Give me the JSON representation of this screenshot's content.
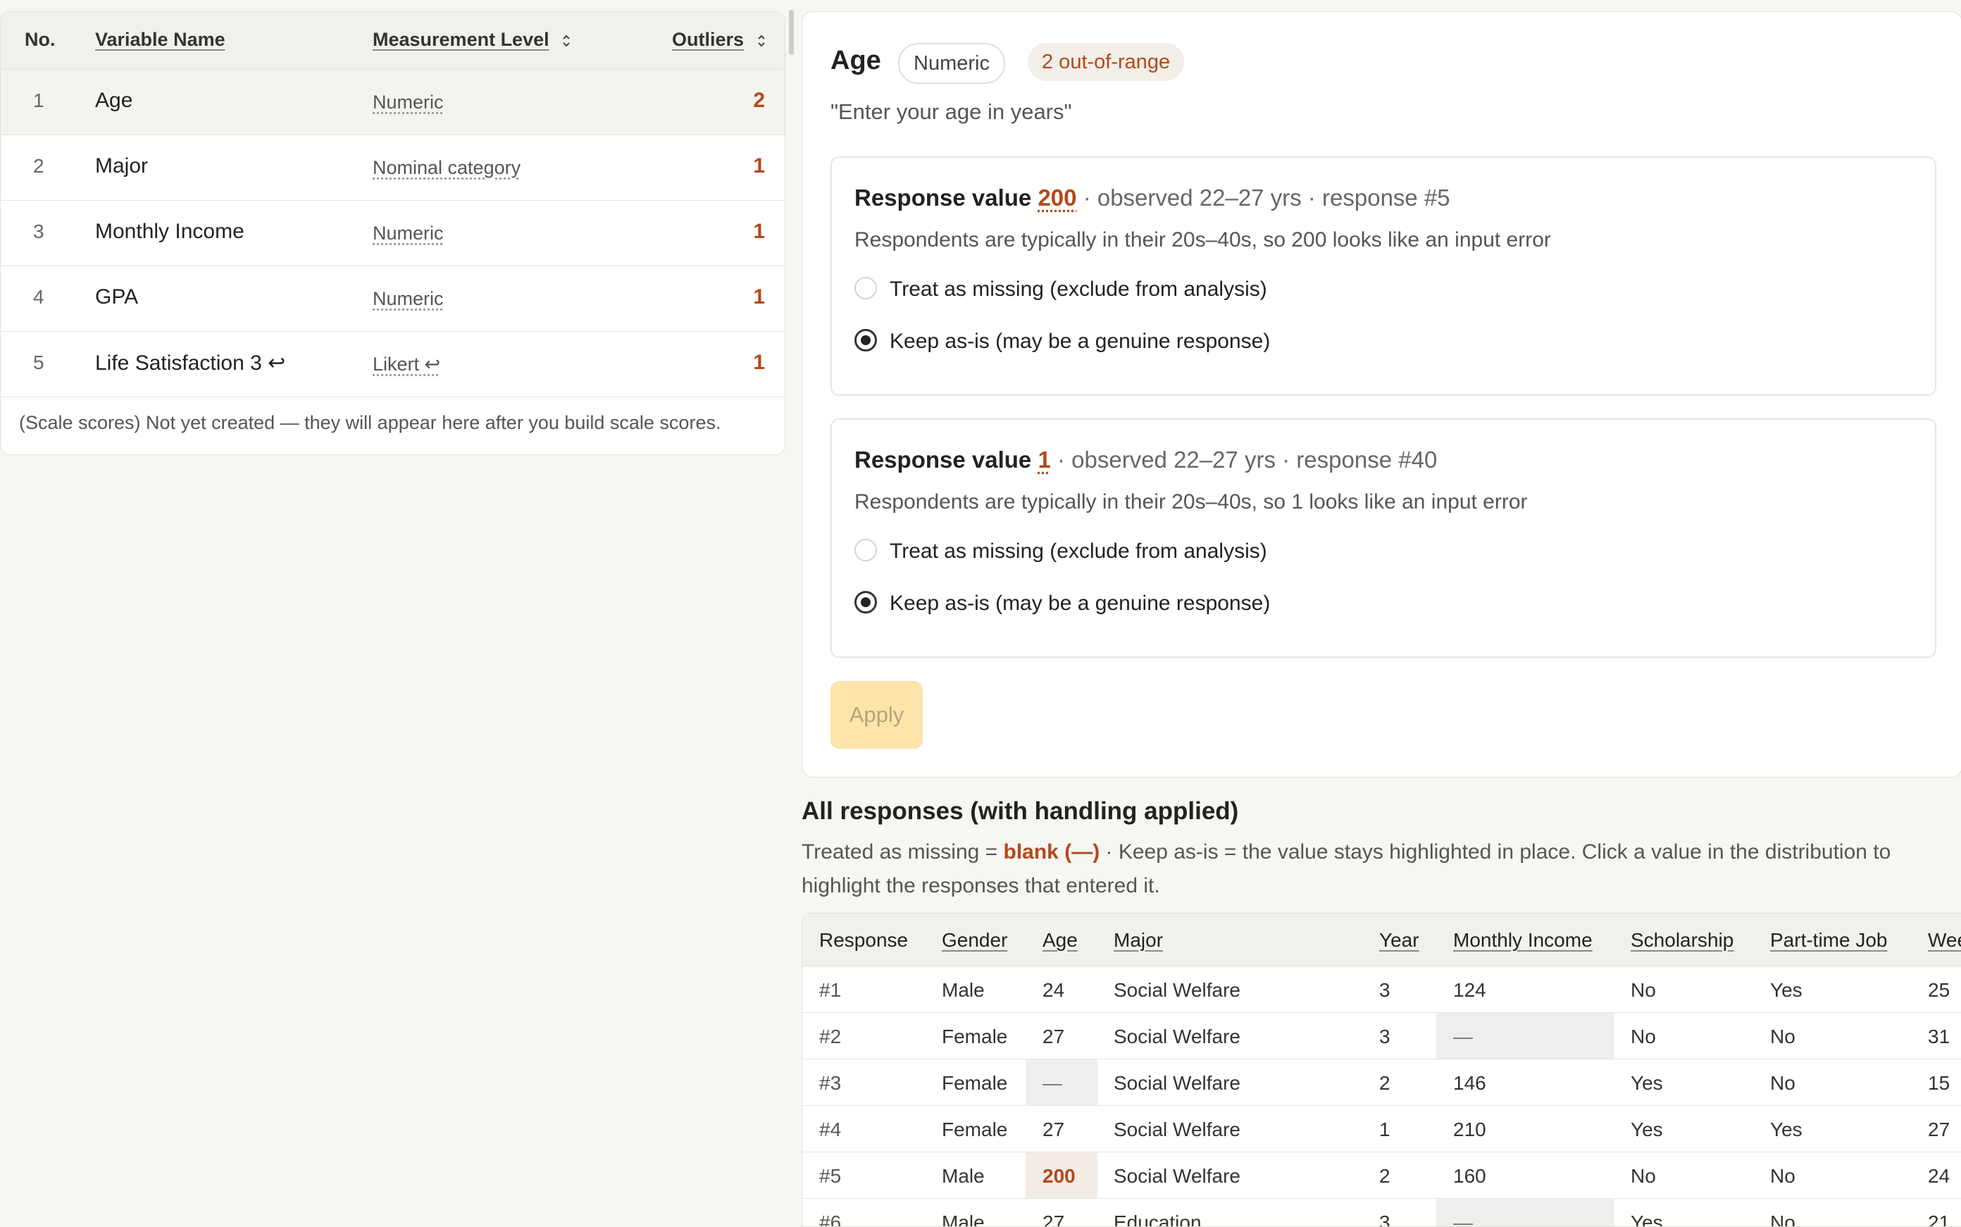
{
  "variables": {
    "headers": {
      "no": "No.",
      "name": "Variable Name",
      "level": "Measurement Level",
      "outliers": "Outliers"
    },
    "rows": [
      {
        "no": "1",
        "name": "Age",
        "level": "Numeric",
        "outliers": "2"
      },
      {
        "no": "2",
        "name": "Major",
        "level": "Nominal category",
        "outliers": "1"
      },
      {
        "no": "3",
        "name": "Monthly Income",
        "level": "Numeric",
        "outliers": "1"
      },
      {
        "no": "4",
        "name": "GPA",
        "level": "Numeric",
        "outliers": "1"
      },
      {
        "no": "5",
        "name": "Life Satisfaction 3 ↩",
        "level": "Likert ↩",
        "outliers": "1"
      }
    ],
    "footer": "(Scale scores) Not yet created — they will appear here after you build scale scores."
  },
  "detail": {
    "title": "Age",
    "level_badge": "Numeric",
    "outlier_badge": "2 out-of-range",
    "prompt": "\"Enter your age in years\"",
    "outliers": [
      {
        "label": "Response value",
        "value": "200",
        "meta": "· observed 22–27 yrs · response #5",
        "desc": "Respondents are typically in their 20s–40s, so 200 looks like an input error",
        "option_missing": "Treat as missing (exclude from analysis)",
        "option_keep": "Keep as-is (may be a genuine response)",
        "selected": "keep"
      },
      {
        "label": "Response value",
        "value": "1",
        "meta": "· observed 22–27 yrs · response #40",
        "desc": "Respondents are typically in their 20s–40s, so 1 looks like an input error",
        "option_missing": "Treat as missing (exclude from analysis)",
        "option_keep": "Keep as-is (may be a genuine response)",
        "selected": "keep"
      }
    ],
    "apply_label": "Apply"
  },
  "responses": {
    "title": "All responses (with handling applied)",
    "desc_prefix": "Treated as missing = ",
    "desc_blank": "blank (—)",
    "desc_suffix": " · Keep as-is = the value stays highlighted in place. Click a value in the distribution to highlight the responses that entered it.",
    "headers": [
      "Response",
      "Gender",
      "Age",
      "Major",
      "Year",
      "Monthly Income",
      "Scholarship",
      "Part-time Job",
      "Wee"
    ],
    "rows": [
      {
        "id": "#1",
        "gender": "Male",
        "age": "24",
        "major": "Social Welfare",
        "year": "3",
        "income": "124",
        "scholarship": "No",
        "job": "Yes",
        "wk": "25"
      },
      {
        "id": "#2",
        "gender": "Female",
        "age": "27",
        "major": "Social Welfare",
        "year": "3",
        "income": "—",
        "scholarship": "No",
        "job": "No",
        "wk": "31"
      },
      {
        "id": "#3",
        "gender": "Female",
        "age": "—",
        "major": "Social Welfare",
        "year": "2",
        "income": "146",
        "scholarship": "Yes",
        "job": "No",
        "wk": "15"
      },
      {
        "id": "#4",
        "gender": "Female",
        "age": "27",
        "major": "Social Welfare",
        "year": "1",
        "income": "210",
        "scholarship": "Yes",
        "job": "Yes",
        "wk": "27"
      },
      {
        "id": "#5",
        "gender": "Male",
        "age": "200",
        "major": "Social Welfare",
        "year": "2",
        "income": "160",
        "scholarship": "No",
        "job": "No",
        "wk": "24"
      },
      {
        "id": "#6",
        "gender": "Male",
        "age": "27",
        "major": "Education",
        "year": "3",
        "income": "—",
        "scholarship": "Yes",
        "job": "No",
        "wk": "21"
      }
    ]
  }
}
